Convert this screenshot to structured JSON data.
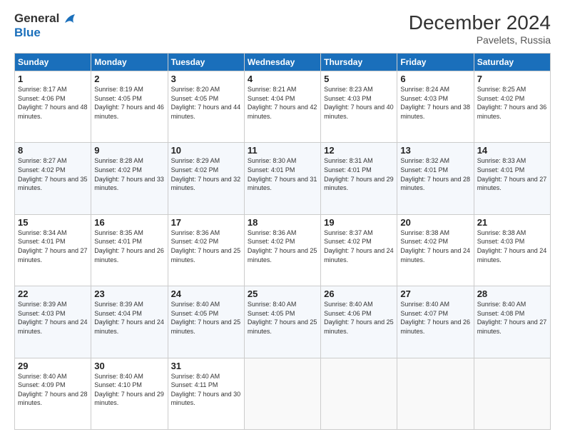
{
  "header": {
    "logo_general": "General",
    "logo_blue": "Blue",
    "title": "December 2024",
    "subtitle": "Pavelets, Russia"
  },
  "weekdays": [
    "Sunday",
    "Monday",
    "Tuesday",
    "Wednesday",
    "Thursday",
    "Friday",
    "Saturday"
  ],
  "weeks": [
    [
      {
        "day": "1",
        "sunrise": "8:17 AM",
        "sunset": "4:06 PM",
        "daylight": "7 hours and 48 minutes."
      },
      {
        "day": "2",
        "sunrise": "8:19 AM",
        "sunset": "4:05 PM",
        "daylight": "7 hours and 46 minutes."
      },
      {
        "day": "3",
        "sunrise": "8:20 AM",
        "sunset": "4:05 PM",
        "daylight": "7 hours and 44 minutes."
      },
      {
        "day": "4",
        "sunrise": "8:21 AM",
        "sunset": "4:04 PM",
        "daylight": "7 hours and 42 minutes."
      },
      {
        "day": "5",
        "sunrise": "8:23 AM",
        "sunset": "4:03 PM",
        "daylight": "7 hours and 40 minutes."
      },
      {
        "day": "6",
        "sunrise": "8:24 AM",
        "sunset": "4:03 PM",
        "daylight": "7 hours and 38 minutes."
      },
      {
        "day": "7",
        "sunrise": "8:25 AM",
        "sunset": "4:02 PM",
        "daylight": "7 hours and 36 minutes."
      }
    ],
    [
      {
        "day": "8",
        "sunrise": "8:27 AM",
        "sunset": "4:02 PM",
        "daylight": "7 hours and 35 minutes."
      },
      {
        "day": "9",
        "sunrise": "8:28 AM",
        "sunset": "4:02 PM",
        "daylight": "7 hours and 33 minutes."
      },
      {
        "day": "10",
        "sunrise": "8:29 AM",
        "sunset": "4:02 PM",
        "daylight": "7 hours and 32 minutes."
      },
      {
        "day": "11",
        "sunrise": "8:30 AM",
        "sunset": "4:01 PM",
        "daylight": "7 hours and 31 minutes."
      },
      {
        "day": "12",
        "sunrise": "8:31 AM",
        "sunset": "4:01 PM",
        "daylight": "7 hours and 29 minutes."
      },
      {
        "day": "13",
        "sunrise": "8:32 AM",
        "sunset": "4:01 PM",
        "daylight": "7 hours and 28 minutes."
      },
      {
        "day": "14",
        "sunrise": "8:33 AM",
        "sunset": "4:01 PM",
        "daylight": "7 hours and 27 minutes."
      }
    ],
    [
      {
        "day": "15",
        "sunrise": "8:34 AM",
        "sunset": "4:01 PM",
        "daylight": "7 hours and 27 minutes."
      },
      {
        "day": "16",
        "sunrise": "8:35 AM",
        "sunset": "4:01 PM",
        "daylight": "7 hours and 26 minutes."
      },
      {
        "day": "17",
        "sunrise": "8:36 AM",
        "sunset": "4:02 PM",
        "daylight": "7 hours and 25 minutes."
      },
      {
        "day": "18",
        "sunrise": "8:36 AM",
        "sunset": "4:02 PM",
        "daylight": "7 hours and 25 minutes."
      },
      {
        "day": "19",
        "sunrise": "8:37 AM",
        "sunset": "4:02 PM",
        "daylight": "7 hours and 24 minutes."
      },
      {
        "day": "20",
        "sunrise": "8:38 AM",
        "sunset": "4:02 PM",
        "daylight": "7 hours and 24 minutes."
      },
      {
        "day": "21",
        "sunrise": "8:38 AM",
        "sunset": "4:03 PM",
        "daylight": "7 hours and 24 minutes."
      }
    ],
    [
      {
        "day": "22",
        "sunrise": "8:39 AM",
        "sunset": "4:03 PM",
        "daylight": "7 hours and 24 minutes."
      },
      {
        "day": "23",
        "sunrise": "8:39 AM",
        "sunset": "4:04 PM",
        "daylight": "7 hours and 24 minutes."
      },
      {
        "day": "24",
        "sunrise": "8:40 AM",
        "sunset": "4:05 PM",
        "daylight": "7 hours and 25 minutes."
      },
      {
        "day": "25",
        "sunrise": "8:40 AM",
        "sunset": "4:05 PM",
        "daylight": "7 hours and 25 minutes."
      },
      {
        "day": "26",
        "sunrise": "8:40 AM",
        "sunset": "4:06 PM",
        "daylight": "7 hours and 25 minutes."
      },
      {
        "day": "27",
        "sunrise": "8:40 AM",
        "sunset": "4:07 PM",
        "daylight": "7 hours and 26 minutes."
      },
      {
        "day": "28",
        "sunrise": "8:40 AM",
        "sunset": "4:08 PM",
        "daylight": "7 hours and 27 minutes."
      }
    ],
    [
      {
        "day": "29",
        "sunrise": "8:40 AM",
        "sunset": "4:09 PM",
        "daylight": "7 hours and 28 minutes."
      },
      {
        "day": "30",
        "sunrise": "8:40 AM",
        "sunset": "4:10 PM",
        "daylight": "7 hours and 29 minutes."
      },
      {
        "day": "31",
        "sunrise": "8:40 AM",
        "sunset": "4:11 PM",
        "daylight": "7 hours and 30 minutes."
      },
      null,
      null,
      null,
      null
    ]
  ],
  "labels": {
    "sunrise": "Sunrise:",
    "sunset": "Sunset:",
    "daylight": "Daylight:"
  }
}
